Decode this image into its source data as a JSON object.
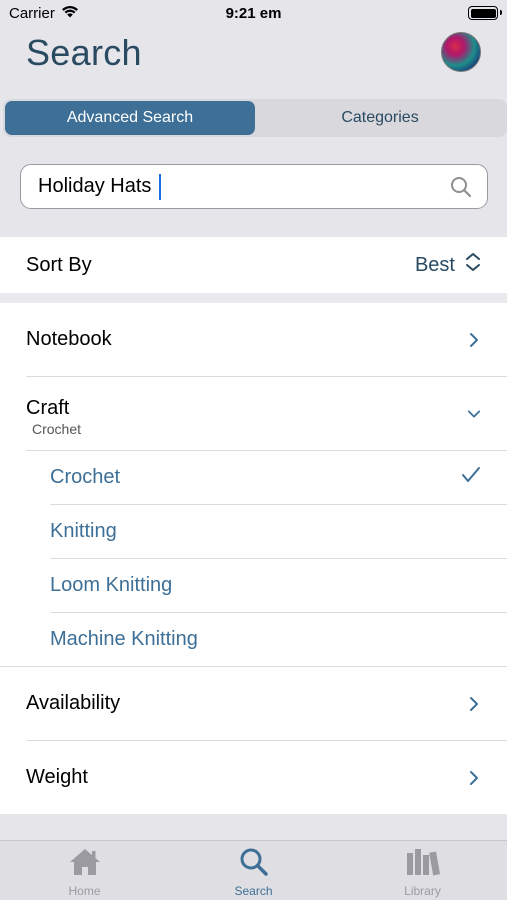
{
  "status_bar": {
    "carrier": "Carrier",
    "time": "9:21 em"
  },
  "header": {
    "title": "Search"
  },
  "segments": [
    {
      "label": "Advanced Search",
      "active": true
    },
    {
      "label": "Categories",
      "active": false
    }
  ],
  "search": {
    "value": "Holiday Hats",
    "placeholder": ""
  },
  "sort": {
    "label": "Sort By",
    "value": "Best"
  },
  "filters": {
    "notebook": {
      "label": "Notebook"
    },
    "craft": {
      "label": "Craft",
      "selected": "Crochet",
      "options": [
        {
          "label": "Crochet",
          "checked": true
        },
        {
          "label": "Knitting",
          "checked": false
        },
        {
          "label": "Loom Knitting",
          "checked": false
        },
        {
          "label": "Machine Knitting",
          "checked": false
        }
      ]
    },
    "availability": {
      "label": "Availability"
    },
    "weight": {
      "label": "Weight"
    }
  },
  "tab_bar": [
    {
      "label": "Home",
      "icon": "home-icon",
      "active": false
    },
    {
      "label": "Search",
      "icon": "search-icon",
      "active": true
    },
    {
      "label": "Library",
      "icon": "library-icon",
      "active": false
    }
  ],
  "colors": {
    "accent": "#3d6f97",
    "title": "#2a4a62",
    "background": "#e5e5ea"
  }
}
